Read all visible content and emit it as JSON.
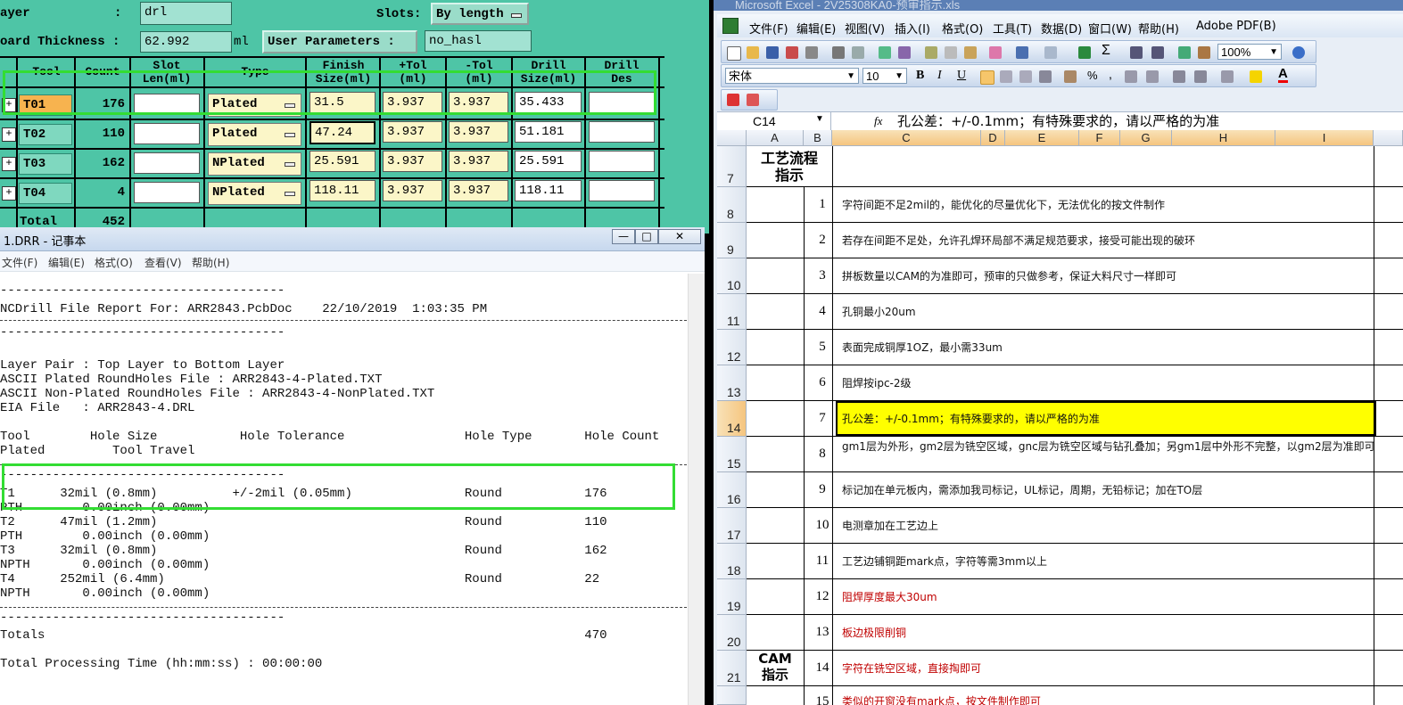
{
  "drill": {
    "layer_label": "ayer",
    "layer_colon": ":",
    "layer_value": "drl",
    "slots_label": "Slots:",
    "slots_value": "By length",
    "board_label": "oard Thickness :",
    "board_value": "62.992",
    "board_unit": "ml",
    "user_params": "User Parameters :",
    "param_value": "no_hasl",
    "headers": {
      "tool": "Tool",
      "count": "Count",
      "slot": "Slot\nLen(ml)",
      "type": "Type",
      "finish": "Finish\nSize(ml)",
      "ptol": "+Tol\n(ml)",
      "ntol": "-Tol\n(ml)",
      "drill_size": "Drill\nSize(ml)",
      "drill_des": "Drill\nDes"
    },
    "rows": [
      {
        "tool": "T01",
        "count": "176",
        "type": "Plated",
        "finish": "31.5",
        "ptol": "3.937",
        "ntol": "3.937",
        "drill": "35.433"
      },
      {
        "tool": "T02",
        "count": "110",
        "type": "Plated",
        "finish": "47.24",
        "ptol": "3.937",
        "ntol": "3.937",
        "drill": "51.181"
      },
      {
        "tool": "T03",
        "count": "162",
        "type": "NPlated",
        "finish": "25.591",
        "ptol": "3.937",
        "ntol": "3.937",
        "drill": "25.591"
      },
      {
        "tool": "T04",
        "count": "4",
        "type": "NPlated",
        "finish": "118.11",
        "ptol": "3.937",
        "ntol": "3.937",
        "drill": "118.11"
      }
    ],
    "total_label": "Total",
    "total_value": "452",
    "highlight_color": "#33dd33"
  },
  "notepad": {
    "title": "1.DRR - 记事本",
    "menu": [
      "文件(F)",
      "编辑(E)",
      "格式(O)",
      "查看(V)",
      "帮助(H)"
    ],
    "lines": [
      "--------------------------------------",
      "NCDrill File Report For: ARR2843.PcbDoc    22/10/2019  1:03:35 PM",
      "--------------------------------------",
      "Layer Pair : Top Layer to Bottom Layer",
      "ASCII Plated RoundHoles File : ARR2843-4-Plated.TXT",
      "ASCII Non-Plated RoundHoles File : ARR2843-4-NonPlated.TXT",
      "EIA File   : ARR2843-4.DRL",
      "Tool        Hole Size           Hole Tolerance                Hole Type       Hole Count",
      "Plated         Tool Travel",
      "--------------------------------------",
      "T1      32mil (0.8mm)          +/-2mil (0.05mm)               Round           176",
      "PTH        0.00inch (0.00mm)",
      "T2      47mil (1.2mm)                                         Round           110",
      "PTH        0.00inch (0.00mm)",
      "T3      32mil (0.8mm)                                         Round           162",
      "NPTH       0.00inch (0.00mm)",
      "T4      252mil (6.4mm)                                        Round           22",
      "NPTH       0.00inch (0.00mm)",
      "--------------------------------------",
      "Totals                                                                        470",
      "Total Processing Time (hh:mm:ss) : 00:00:00"
    ]
  },
  "excel": {
    "title": "Microsoft Excel - 2V25308KA0-预审指示.xls",
    "menu": [
      "文件(F)",
      "编辑(E)",
      "视图(V)",
      "插入(I)",
      "格式(O)",
      "工具(T)",
      "数据(D)",
      "窗口(W)",
      "帮助(H)",
      "Adobe PDF(B)"
    ],
    "zoom": "100%",
    "font_name": "宋体",
    "font_size": "10",
    "cell_ref": "C14",
    "fx": "fx",
    "formula": "孔公差：+/-0.1mm；有特殊要求的，请以严格的为准",
    "columns": [
      "A",
      "B",
      "C",
      "D",
      "E",
      "F",
      "G",
      "H",
      "I"
    ],
    "section1": "工艺流程\n指示",
    "section2": "CAM\n指示",
    "rows": [
      {
        "row": "7",
        "num": "",
        "text": ""
      },
      {
        "row": "8",
        "num": "1",
        "text": "字符间距不足2mil的，能优化的尽量优化下，无法优化的按文件制作"
      },
      {
        "row": "9",
        "num": "2",
        "text": "若存在间距不足处，允许孔焊环局部不满足规范要求，接受可能出现的破环"
      },
      {
        "row": "10",
        "num": "3",
        "text": "拼板数量以CAM的为准即可，预审的只做参考，保证大料尺寸一样即可"
      },
      {
        "row": "11",
        "num": "4",
        "text": "孔铜最小20um"
      },
      {
        "row": "12",
        "num": "5",
        "text": "表面完成铜厚1OZ，最小需33um"
      },
      {
        "row": "13",
        "num": "6",
        "text": "阻焊按ipc-2级"
      },
      {
        "row": "14",
        "num": "7",
        "text": "孔公差：+/-0.1mm；有特殊要求的，请以严格的为准"
      },
      {
        "row": "15",
        "num": "8",
        "text": "gm1层为外形，gm2层为铣空区域，gnc层为铣空区域与钻孔叠加；另gm1层中外形不完整，以gm2层为准即可"
      },
      {
        "row": "16",
        "num": "9",
        "text": "标记加在单元板内，需添加我司标记，UL标记，周期，无铅标记；加在TO层"
      },
      {
        "row": "17",
        "num": "10",
        "text": "电测章加在工艺边上"
      },
      {
        "row": "18",
        "num": "11",
        "text": "工艺边铺铜距mark点，字符等需3mm以上"
      },
      {
        "row": "19",
        "num": "12",
        "text": "阻焊厚度最大30um"
      },
      {
        "row": "20",
        "num": "13",
        "text": "板边极限削铜"
      },
      {
        "row": "21",
        "num": "14",
        "text": "字符在铣空区域，直接掏即可"
      },
      {
        "row": "",
        "num": "15",
        "text": "类似的开窗没有mark点，按文件制作即可"
      }
    ]
  }
}
